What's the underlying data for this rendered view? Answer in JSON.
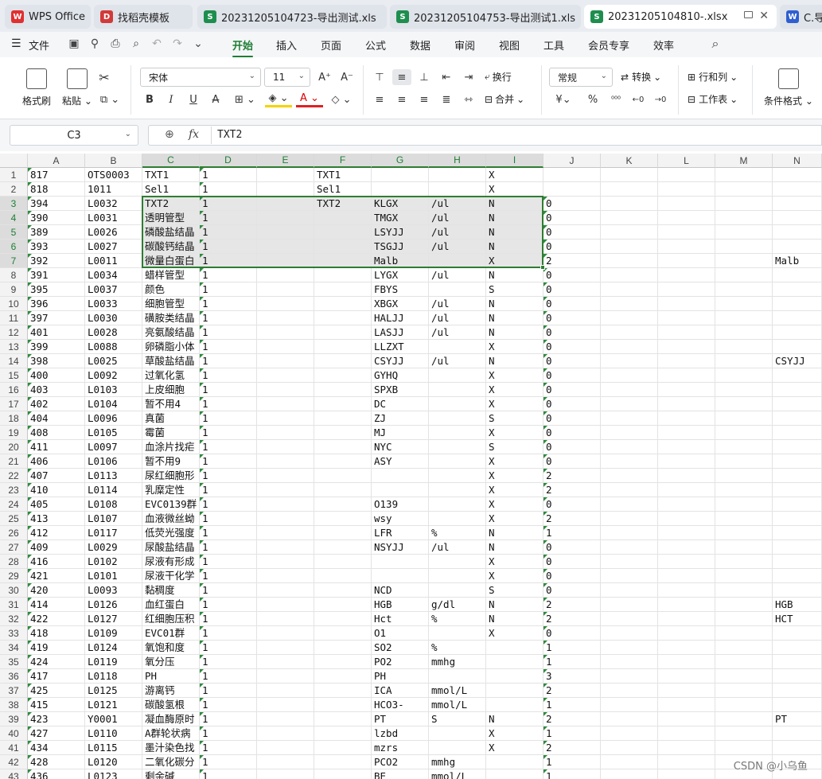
{
  "tabs": [
    {
      "label": "WPS Office",
      "icon": "W",
      "color": "#e03030"
    },
    {
      "label": "找稻壳模板",
      "icon": "D",
      "color": "#d23a3a"
    },
    {
      "label": "20231205104723-导出测试.xls",
      "icon": "S",
      "color": "#1e8e4f"
    },
    {
      "label": "20231205104753-导出测试1.xls",
      "icon": "S",
      "color": "#1e8e4f"
    },
    {
      "label": "20231205104810-.xlsx",
      "icon": "S",
      "color": "#1e8e4f"
    },
    {
      "label": "C.导",
      "icon": "W",
      "color": "#2f5fd0"
    }
  ],
  "menu": {
    "file": "文件",
    "items": [
      "开始",
      "插入",
      "页面",
      "公式",
      "数据",
      "审阅",
      "视图",
      "工具",
      "会员专享",
      "效率"
    ],
    "active": "开始"
  },
  "ribbon": {
    "format_painter": "格式刷",
    "paste": "粘贴",
    "font_name": "宋体",
    "font_size": "11",
    "wrap": "换行",
    "merge": "合并",
    "number_format": "常规",
    "convert": "转换",
    "rows_cols": "行和列",
    "worksheet": "工作表",
    "cond_format": "条件格式",
    "percent": "%",
    "currency": "¥"
  },
  "formula": {
    "name_box": "C3",
    "fx": "fx",
    "value": "TXT2"
  },
  "columns": [
    "A",
    "B",
    "C",
    "D",
    "E",
    "F",
    "G",
    "H",
    "I",
    "J",
    "K",
    "L",
    "M",
    "N"
  ],
  "selected_cell": "C3",
  "rows": [
    {
      "n": "1",
      "A": "817",
      "B": "OTS0003",
      "C": "TXT1",
      "D": "1",
      "F": "TXT1",
      "I": "X"
    },
    {
      "n": "2",
      "A": "818",
      "B": "1011",
      "C": "Sel1",
      "D": "1",
      "F": "Sel1",
      "I": "X"
    },
    {
      "n": "3",
      "A": "394",
      "B": "L0032",
      "C": "TXT2",
      "D": "1",
      "F": "TXT2",
      "G": "KLGX",
      "H": "/ul",
      "I": "N",
      "J": "0"
    },
    {
      "n": "4",
      "A": "390",
      "B": "L0031",
      "C": "透明管型",
      "D": "1",
      "G": "TMGX",
      "H": "/ul",
      "I": "N",
      "J": "0"
    },
    {
      "n": "5",
      "A": "389",
      "B": "L0026",
      "C": "磷酸盐结晶",
      "D": "1",
      "G": "LSYJJ",
      "H": "/ul",
      "I": "N",
      "J": "0"
    },
    {
      "n": "6",
      "A": "393",
      "B": "L0027",
      "C": "碳酸钙结晶",
      "D": "1",
      "G": "TSGJJ",
      "H": "/ul",
      "I": "N",
      "J": "0"
    },
    {
      "n": "7",
      "A": "392",
      "B": "L0011",
      "C": "微量白蛋白",
      "D": "1",
      "G": "Malb",
      "I": "X",
      "J": "2",
      "N": "Malb"
    },
    {
      "n": "8",
      "A": "391",
      "B": "L0034",
      "C": "蜡样管型",
      "D": "1",
      "G": "LYGX",
      "H": "/ul",
      "I": "N",
      "J": "0"
    },
    {
      "n": "9",
      "A": "395",
      "B": "L0037",
      "C": "颜色",
      "D": "1",
      "G": "FBYS",
      "I": "S",
      "J": "0"
    },
    {
      "n": "10",
      "A": "396",
      "B": "L0033",
      "C": "细胞管型",
      "D": "1",
      "G": "XBGX",
      "H": "/ul",
      "I": "N",
      "J": "0"
    },
    {
      "n": "11",
      "A": "397",
      "B": "L0030",
      "C": "磺胺类结晶",
      "D": "1",
      "G": "HALJJ",
      "H": "/ul",
      "I": "N",
      "J": "0"
    },
    {
      "n": "12",
      "A": "401",
      "B": "L0028",
      "C": "亮氨酸结晶",
      "D": "1",
      "G": "LASJJ",
      "H": "/ul",
      "I": "N",
      "J": "0"
    },
    {
      "n": "13",
      "A": "399",
      "B": "L0088",
      "C": "卵磷脂小体",
      "D": "1",
      "G": "LLZXT",
      "I": "X",
      "J": "0"
    },
    {
      "n": "14",
      "A": "398",
      "B": "L0025",
      "C": "草酸盐结晶",
      "D": "1",
      "G": "CSYJJ",
      "H": "/ul",
      "I": "N",
      "J": "0",
      "N": "CSYJJ"
    },
    {
      "n": "15",
      "A": "400",
      "B": "L0092",
      "C": "过氧化氢",
      "D": "1",
      "G": "GYHQ",
      "I": "X",
      "J": "0"
    },
    {
      "n": "16",
      "A": "403",
      "B": "L0103",
      "C": "上皮细胞",
      "D": "1",
      "G": "SPXB",
      "I": "X",
      "J": "0"
    },
    {
      "n": "17",
      "A": "402",
      "B": "L0104",
      "C": "暂不用4",
      "D": "1",
      "G": "DC",
      "I": "X",
      "J": "0"
    },
    {
      "n": "18",
      "A": "404",
      "B": "L0096",
      "C": "真菌",
      "D": "1",
      "G": "ZJ",
      "I": "S",
      "J": "0"
    },
    {
      "n": "19",
      "A": "408",
      "B": "L0105",
      "C": "霉菌",
      "D": "1",
      "G": "MJ",
      "I": "X",
      "J": "0"
    },
    {
      "n": "20",
      "A": "411",
      "B": "L0097",
      "C": "血涂片找疟",
      "D": "1",
      "G": "NYC",
      "I": "S",
      "J": "0"
    },
    {
      "n": "21",
      "A": "406",
      "B": "L0106",
      "C": "暂不用9",
      "D": "1",
      "G": "ASY",
      "I": "X",
      "J": "0"
    },
    {
      "n": "22",
      "A": "407",
      "B": "L0113",
      "C": "尿红细胞形",
      "D": "1",
      "I": "X",
      "J": "2"
    },
    {
      "n": "23",
      "A": "410",
      "B": "L0114",
      "C": "乳糜定性",
      "D": "1",
      "I": "X",
      "J": "2"
    },
    {
      "n": "24",
      "A": "405",
      "B": "L0108",
      "C": "EVC0139群",
      "D": "1",
      "G": "O139",
      "I": "X",
      "J": "0"
    },
    {
      "n": "25",
      "A": "413",
      "B": "L0107",
      "C": "血液微丝蚴",
      "D": "1",
      "G": "wsy",
      "I": "X",
      "J": "2"
    },
    {
      "n": "26",
      "A": "412",
      "B": "L0117",
      "C": "低荧光强度",
      "D": "1",
      "G": "LFR",
      "H": "%",
      "I": "N",
      "J": "1"
    },
    {
      "n": "27",
      "A": "409",
      "B": "L0029",
      "C": "尿酸盐结晶",
      "D": "1",
      "G": "NSYJJ",
      "H": "/ul",
      "I": "N",
      "J": "0"
    },
    {
      "n": "28",
      "A": "416",
      "B": "L0102",
      "C": "尿液有形成",
      "D": "1",
      "I": "X",
      "J": "0"
    },
    {
      "n": "29",
      "A": "421",
      "B": "L0101",
      "C": "尿液干化学",
      "D": "1",
      "I": "X",
      "J": "0"
    },
    {
      "n": "30",
      "A": "420",
      "B": "L0093",
      "C": "黏稠度",
      "D": "1",
      "G": "NCD",
      "I": "S",
      "J": "0"
    },
    {
      "n": "31",
      "A": "414",
      "B": "L0126",
      "C": "血红蛋白",
      "D": "1",
      "G": "HGB",
      "H": "g/dl",
      "I": "N",
      "J": "2",
      "N": "HGB"
    },
    {
      "n": "32",
      "A": "422",
      "B": "L0127",
      "C": "红细胞压积",
      "D": "1",
      "G": "Hct",
      "H": "%",
      "I": "N",
      "J": "2",
      "N": "HCT"
    },
    {
      "n": "33",
      "A": "418",
      "B": "L0109",
      "C": "EVC01群",
      "D": "1",
      "G": "O1",
      "I": "X",
      "J": "0"
    },
    {
      "n": "34",
      "A": "419",
      "B": "L0124",
      "C": "氧饱和度",
      "D": "1",
      "G": "SO2",
      "H": "%",
      "J": "1"
    },
    {
      "n": "35",
      "A": "424",
      "B": "L0119",
      "C": "氧分压",
      "D": "1",
      "G": "PO2",
      "H": "mmhg",
      "J": "1"
    },
    {
      "n": "36",
      "A": "417",
      "B": "L0118",
      "C": "PH",
      "D": "1",
      "G": "PH",
      "J": "3"
    },
    {
      "n": "37",
      "A": "425",
      "B": "L0125",
      "C": "游离钙",
      "D": "1",
      "G": "ICA",
      "H": "mmol/L",
      "J": "2"
    },
    {
      "n": "38",
      "A": "415",
      "B": "L0121",
      "C": "碳酸氢根",
      "D": "1",
      "G": "HCO3-",
      "H": "mmol/L",
      "J": "1"
    },
    {
      "n": "39",
      "A": "423",
      "B": "Y0001",
      "C": "凝血酶原时",
      "D": "1",
      "G": "PT",
      "H": "S",
      "I": "N",
      "J": "2",
      "N": "PT"
    },
    {
      "n": "40",
      "A": "427",
      "B": "L0110",
      "C": "A群轮状病",
      "D": "1",
      "G": "lzbd",
      "I": "X",
      "J": "1"
    },
    {
      "n": "41",
      "A": "434",
      "B": "L0115",
      "C": "墨汁染色找",
      "D": "1",
      "G": "mzrs",
      "I": "X",
      "J": "2"
    },
    {
      "n": "42",
      "A": "428",
      "B": "L0120",
      "C": "二氧化碳分",
      "D": "1",
      "G": "PCO2",
      "H": "mmhg",
      "J": "1"
    },
    {
      "n": "43",
      "A": "436",
      "B": "L0123",
      "C": "剩余碱",
      "D": "1",
      "G": "BE",
      "H": "mmol/L",
      "J": "1"
    }
  ],
  "watermark": "CSDN @小乌鱼"
}
